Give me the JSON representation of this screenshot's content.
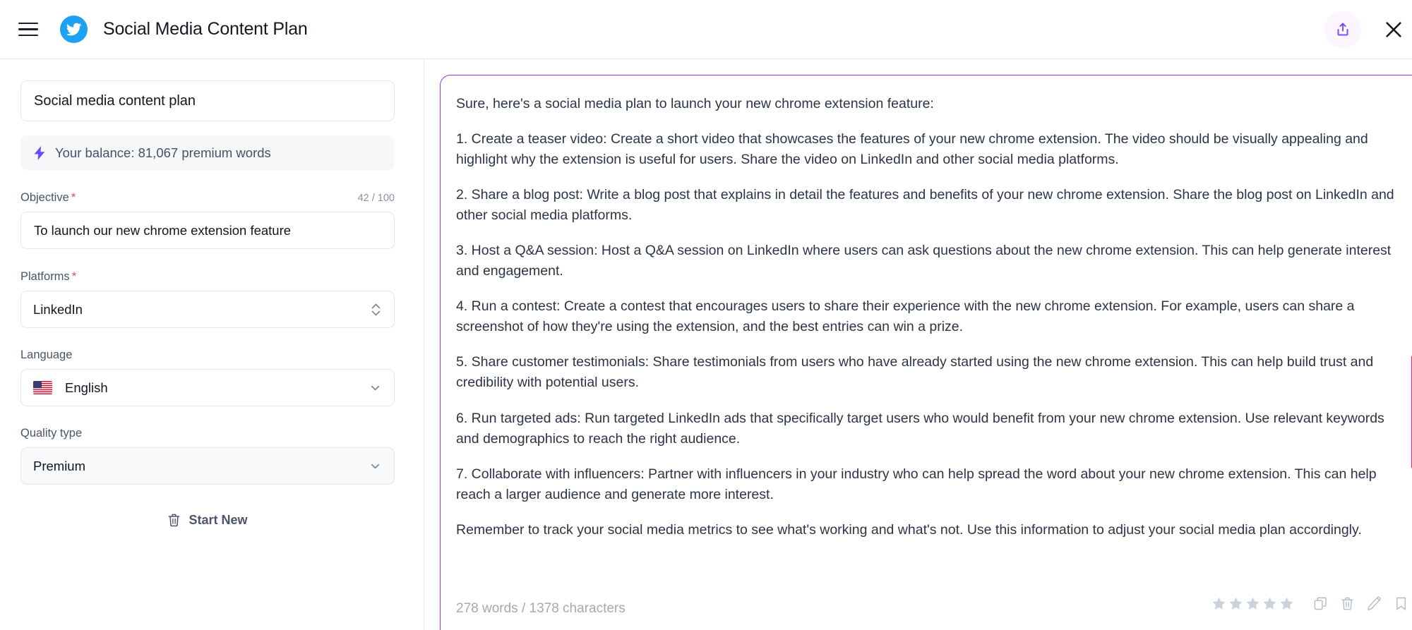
{
  "header": {
    "title": "Social Media Content Plan",
    "menu_icon": "hamburger-menu-icon",
    "logo_icon": "twitter-bird-icon",
    "share_icon": "share-upload-icon",
    "close_icon": "close-x-icon"
  },
  "sidebar": {
    "title_value": "Social media content plan",
    "title_placeholder": "Social media content plan",
    "balance": {
      "icon": "lightning-bolt-icon",
      "text": "Your balance: 81,067 premium words"
    },
    "objective": {
      "label": "Objective",
      "required": "*",
      "counter": "42 / 100",
      "value": "To launch our new chrome extension feature",
      "placeholder": "To launch our new chrome extension feature"
    },
    "platforms": {
      "label": "Platforms",
      "required": "*",
      "value": "LinkedIn",
      "icon": "stepper-chevrons-icon"
    },
    "language": {
      "label": "Language",
      "value": "English",
      "flag": "us-flag-icon",
      "icon": "chevron-down-icon"
    },
    "quality": {
      "label": "Quality type",
      "value": "Premium",
      "icon": "chevron-down-icon"
    },
    "start_new": {
      "label": "Start New",
      "icon": "trash-icon"
    }
  },
  "result": {
    "paragraphs": [
      "Sure, here's a social media plan to launch your new chrome extension feature:",
      "1. Create a teaser video: Create a short video that showcases the features of your new chrome extension. The video should be visually appealing and highlight why the extension is useful for users. Share the video on LinkedIn and other social media platforms.",
      "2. Share a blog post: Write a blog post that explains in detail the features and benefits of your new chrome extension. Share the blog post on LinkedIn and other social media platforms.",
      "3. Host a Q&A session: Host a Q&A session on LinkedIn where users can ask questions about the new chrome extension. This can help generate interest and engagement.",
      "4. Run a contest: Create a contest that encourages users to share their experience with the new chrome extension. For example, users can share a screenshot of how they're using the extension, and the best entries can win a prize.",
      "5. Share customer testimonials: Share testimonials from users who have already started using the new chrome extension. This can help build trust and credibility with potential users.",
      "6. Run targeted ads: Run targeted LinkedIn ads that specifically target users who would benefit from your new chrome extension. Use relevant keywords and demographics to reach the right audience.",
      "7. Collaborate with influencers: Partner with influencers in your industry who can help spread the word about your new chrome extension. This can help reach a larger audience and generate more interest.",
      "Remember to track your social media metrics to see what's working and what's not. Use this information to adjust your social media plan accordingly."
    ],
    "wordcount": "278 words / 1378 characters",
    "rating": {
      "icon": "star-icon",
      "value": 0,
      "max": 5
    },
    "actions": [
      {
        "name": "copy-icon",
        "label": "Copy"
      },
      {
        "name": "trash-icon",
        "label": "Delete"
      },
      {
        "name": "edit-pencil-icon",
        "label": "Edit"
      },
      {
        "name": "bookmark-icon",
        "label": "Bookmark"
      }
    ]
  },
  "colors": {
    "brand_blue": "#1DA1F2",
    "accent_purple": "#a32ee0",
    "share_purple": "#7c4dff",
    "scrollbar_pink": "#f5227f",
    "required_red": "#f0415c"
  }
}
